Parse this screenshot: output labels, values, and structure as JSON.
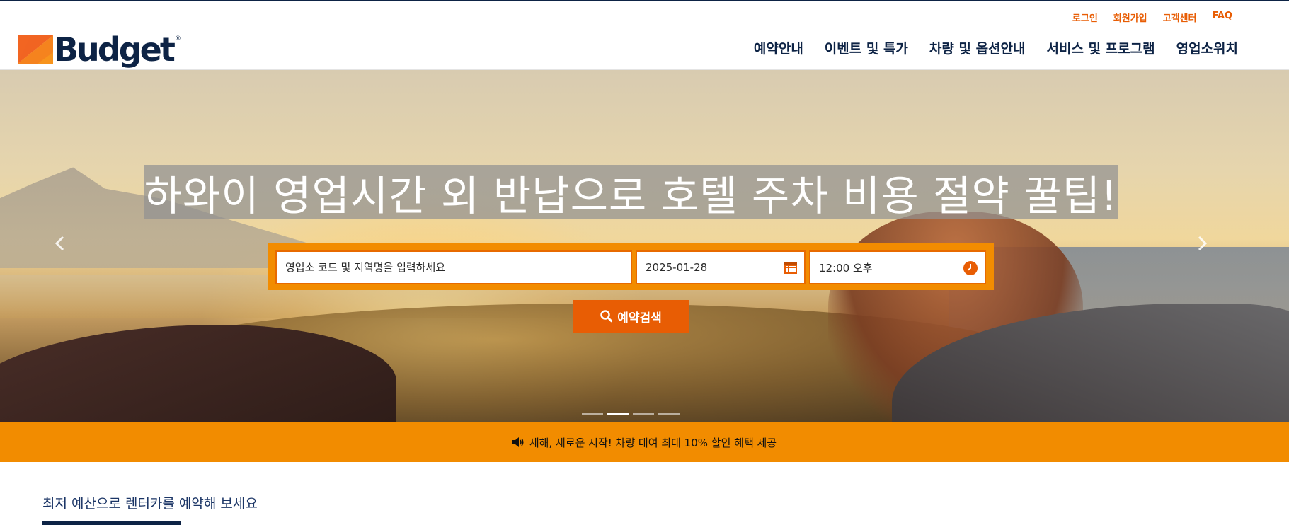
{
  "brand": {
    "name": "Budget",
    "reg": "®"
  },
  "util_nav": [
    "로그인",
    "회원가입",
    "고객센터",
    "FAQ"
  ],
  "main_nav": [
    "예약안내",
    "이벤트 및 특가",
    "차량 및 옵션안내",
    "서비스 및 프로그램",
    "영업소위치"
  ],
  "hero": {
    "headline": "하와이 영업시간 외 반납으로 호텔 주차 비용 절약 꿀팁!",
    "location_placeholder": "영업소 코드 및 지역명을 입력하세요",
    "date_value": "2025-01-28",
    "time_value": "12:00 오후",
    "search_label": "예약검색",
    "slide_count": 4,
    "active_slide": 2
  },
  "notice": {
    "text": "새해, 새로운 시작! 차량 대여 최대 10% 할인 혜택 제공"
  },
  "section": {
    "title": "최저 예산으로 렌터카를 예약해 보세요"
  },
  "colors": {
    "brand_orange": "#f28c00",
    "accent_orange": "#e85d04",
    "navy": "#0d2345"
  },
  "icons": [
    "budget-logo-mark",
    "chevron-left-icon",
    "chevron-right-icon",
    "calendar-icon",
    "clock-icon",
    "search-icon",
    "speaker-icon"
  ]
}
